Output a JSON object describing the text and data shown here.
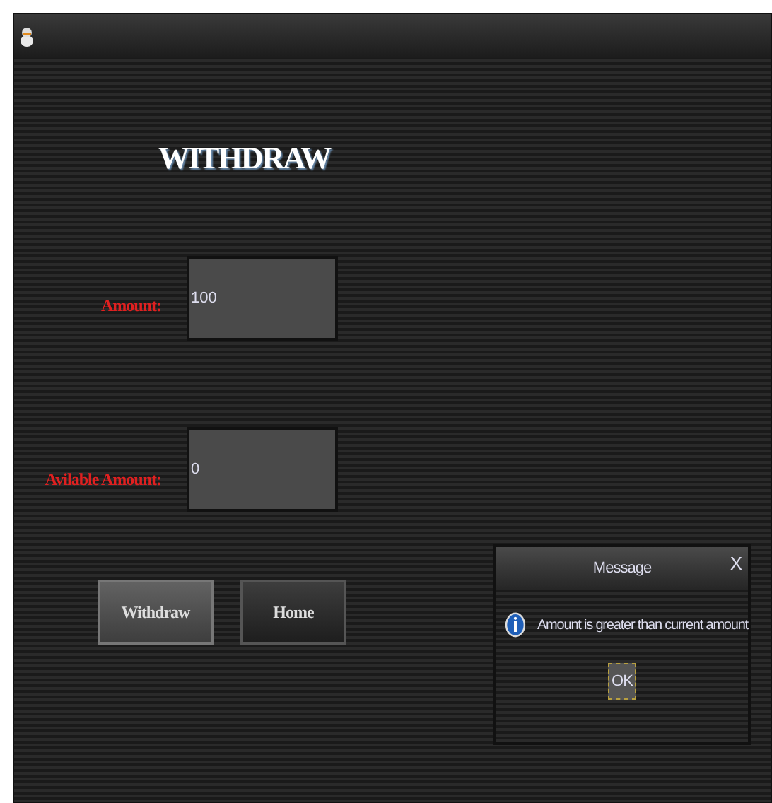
{
  "heading": "WITHDRAW",
  "fields": [
    {
      "label": "Amount:",
      "value": "100"
    },
    {
      "label": "Avilable Amount:",
      "value": "0"
    }
  ],
  "buttons": [
    {
      "label": "Withdraw",
      "selected": true
    },
    {
      "label": "Home",
      "selected": false
    }
  ],
  "dialog": {
    "title": "Message",
    "close": "X",
    "message": "Amount is greater than current amount",
    "button": "OK"
  }
}
